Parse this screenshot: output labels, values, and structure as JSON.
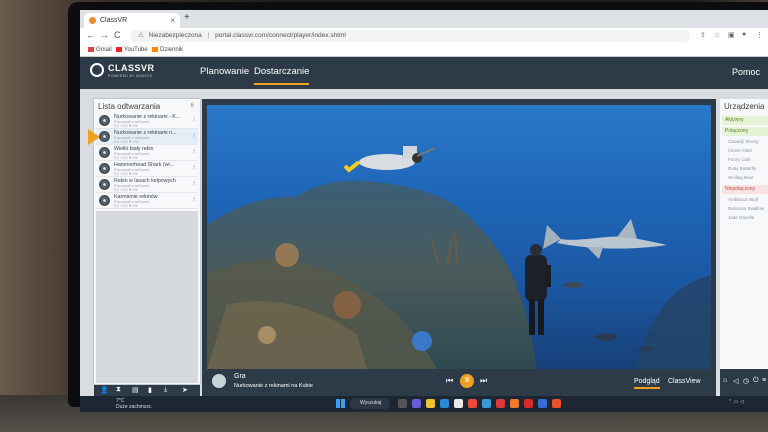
{
  "browser": {
    "tab_title": "ClassVR",
    "tab_close": "×",
    "new_tab": "+",
    "nav": {
      "back": "←",
      "forward": "→",
      "reload": "C"
    },
    "warning_icon": "warning-icon",
    "security_label": "Niezabezpieczona",
    "url": "portal.classvr.com/connect/player/index.shtml",
    "bookmarks": [
      "Gmail",
      "YouTube",
      "Dziennik"
    ]
  },
  "app": {
    "logo": "CLASSVR",
    "logo_sub": "POWERED BY AVANTIS",
    "tabs": [
      "Planowanie",
      "Dostarczanie"
    ],
    "active_tab": 1,
    "help": "Pomoc"
  },
  "playlist": {
    "title": "Lista odtwarzania",
    "count": "6",
    "items": [
      {
        "title": "Nurkowanie z rekinami - K...",
        "sub": "Pozostałe z rekinami",
        "meta": "3.5 / 100 ⚑ 4%"
      },
      {
        "title": "Nurkowanie z rekinami n...",
        "sub": "Pozostałe z rekinami",
        "meta": "3.5 / 100 ⚑ 4%"
      },
      {
        "title": "Wielki biały rekin",
        "sub": "Pozostałe z rekinami",
        "meta": "3.5 / 100 ⚑ 4%"
      },
      {
        "title": "Hammerhead Shark (wi...",
        "sub": "Pozostałe z rekinami",
        "meta": "3.5 / 100 ⚑ 4%"
      },
      {
        "title": "Rekin w lasach kelpowych",
        "sub": "Pozostałe z rekinami",
        "meta": "3.5 / 100 ⚑ 4%"
      },
      {
        "title": "Karmienie rekinów",
        "sub": "Pozostałe z rekinami",
        "meta": "3.5 / 100 ⚑ 4%"
      }
    ],
    "active_index": 1,
    "tools": [
      "user-icon",
      "timer-icon",
      "save-icon",
      "delete-icon",
      "download-icon",
      "send-icon"
    ]
  },
  "player": {
    "mode_label": "Gra",
    "now_playing": "Nurkowanie z rekinami na Kubie",
    "prev": "⏮",
    "pause": "II",
    "next": "⏭",
    "view_modes": [
      "Podgląd",
      "ClassView"
    ],
    "active_view": 0
  },
  "devices": {
    "title": "Urządzenia",
    "groups": {
      "active": "Aktywny",
      "connected": "Połączony",
      "disconnected": "Niepołączony"
    },
    "connected_devices": [
      "Cassidy Strong",
      "Clever Otter",
      "Funny Lark",
      "Ruby Butterfly",
      "Smiling Bear"
    ],
    "disconnected_devices": [
      "Ambitious Wolf",
      "Delicious Swallow",
      "Jade Gazelle"
    ],
    "tools": [
      "home-icon",
      "mute-icon",
      "timer-icon",
      "power-icon",
      "filter-icon"
    ]
  },
  "taskbar": {
    "weather_temp": "7°C",
    "weather_text": "Duże zachmurz.",
    "search": "Wyszukaj"
  }
}
